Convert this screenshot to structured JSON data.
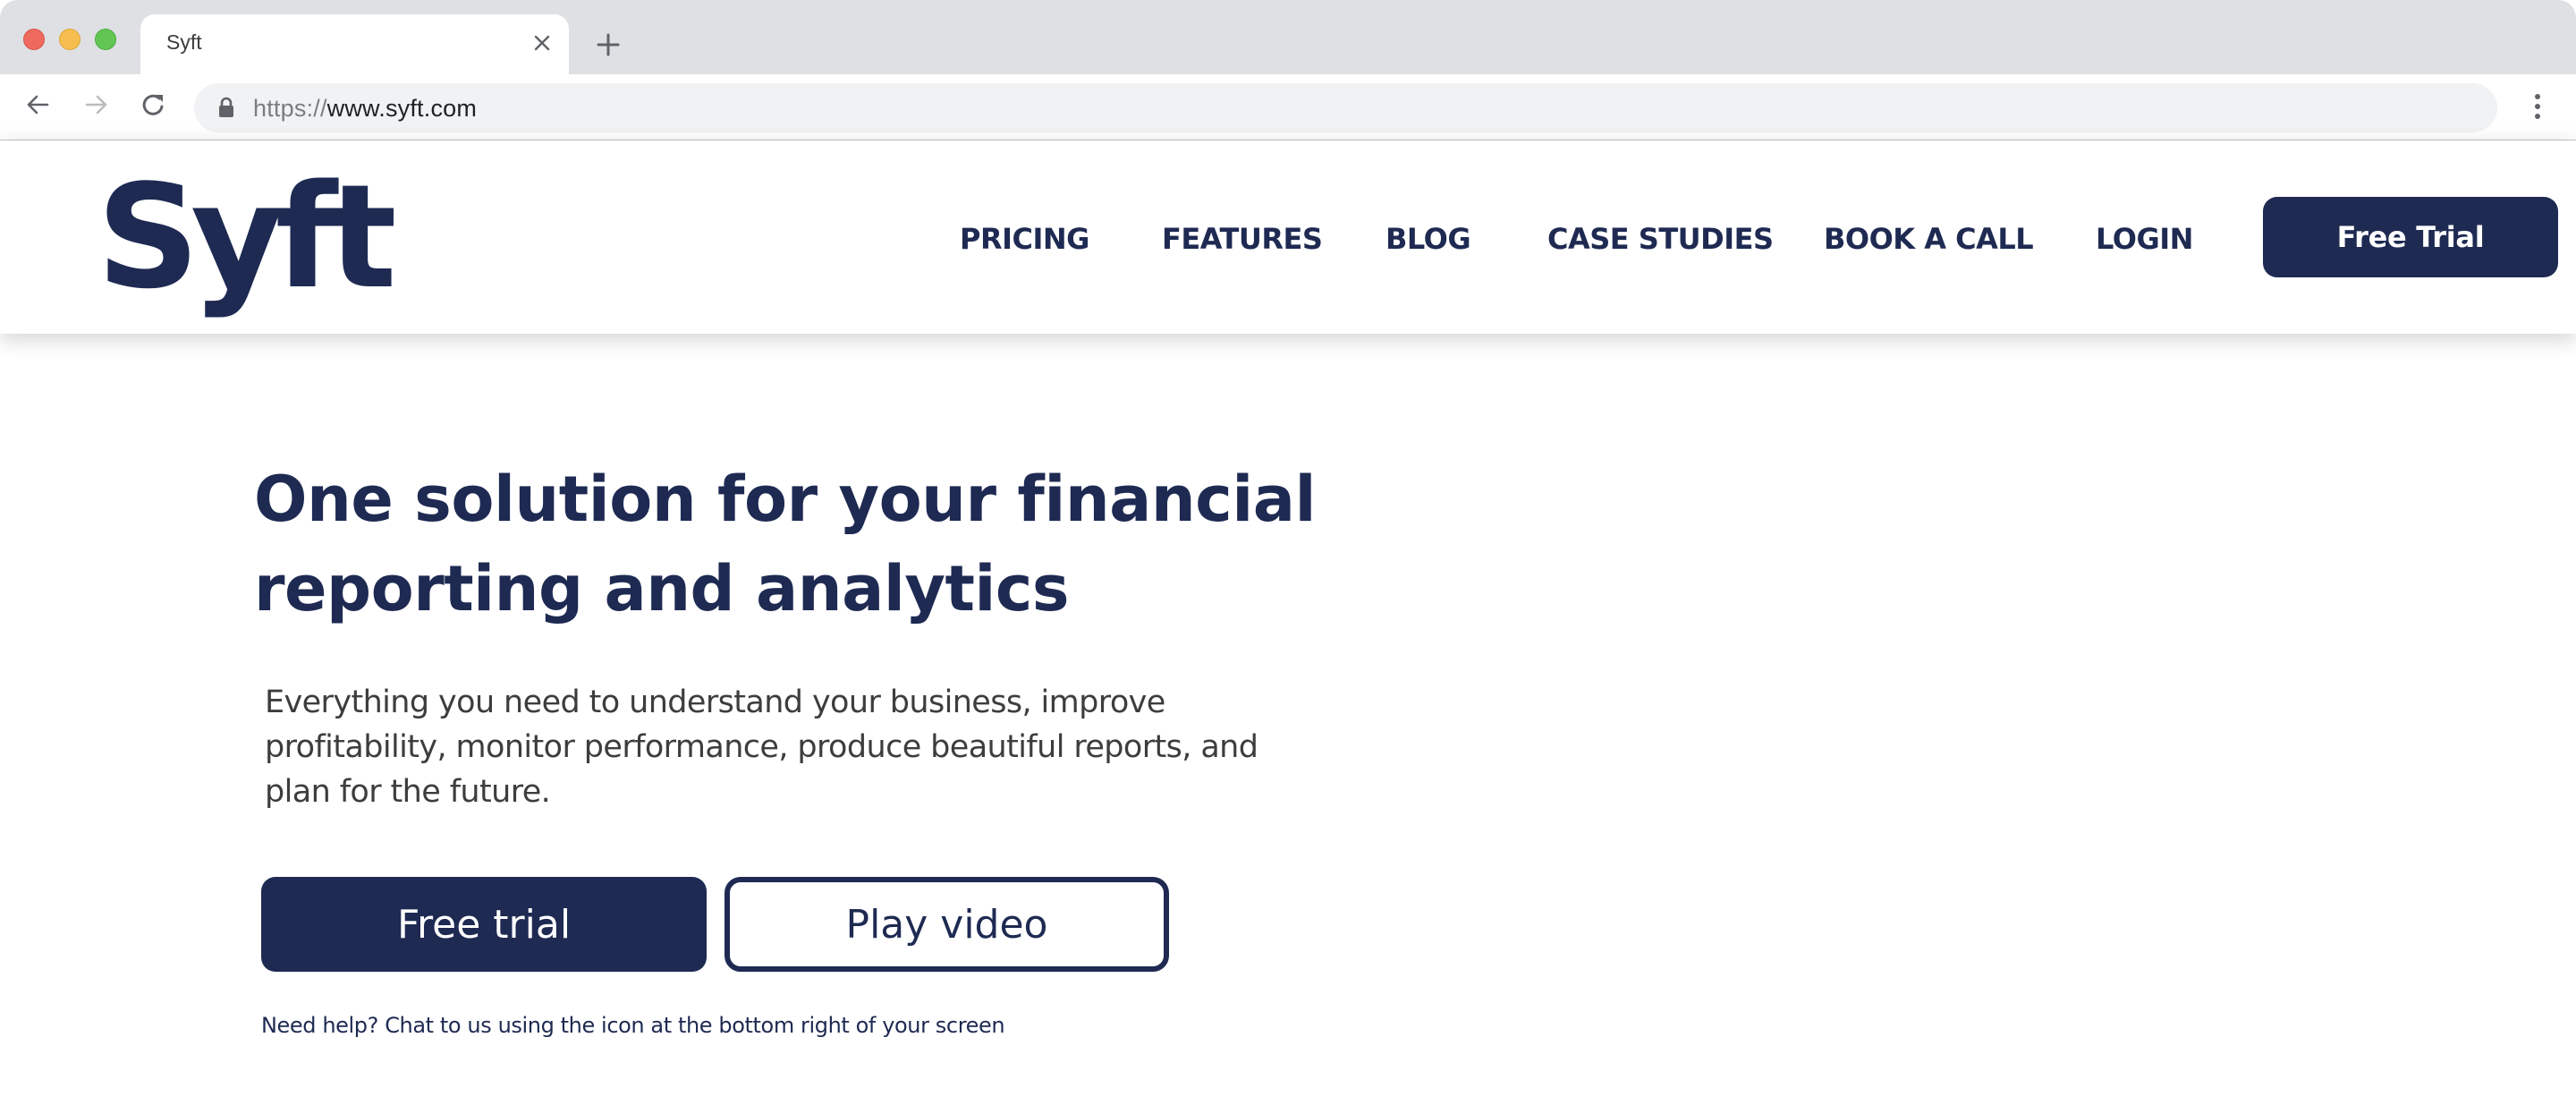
{
  "browser": {
    "tab": {
      "title": "Syft",
      "close_icon": "close-icon"
    },
    "new_tab_icon": "plus-icon",
    "nav": {
      "back_icon": "arrow-left-icon",
      "forward_icon": "arrow-right-icon",
      "reload_icon": "reload-icon"
    },
    "address_bar": {
      "lock_icon": "lock-icon",
      "scheme": "https://",
      "host": "www.syft.com"
    },
    "menu_icon": "kebab-menu-icon"
  },
  "header": {
    "logo": "Syft",
    "nav": [
      {
        "label": "PRICING"
      },
      {
        "label": "FEATURES"
      },
      {
        "label": "BLOG"
      },
      {
        "label": "CASE STUDIES"
      },
      {
        "label": "BOOK A CALL"
      },
      {
        "label": "LOGIN"
      }
    ],
    "cta_label": "Free Trial"
  },
  "hero": {
    "title": "One solution for your financial reporting and analytics",
    "subtitle": "Everything you need to understand your business, improve profitability, monitor performance, produce beautiful reports, and plan for the future.",
    "primary_button": "Free trial",
    "secondary_button": "Play video",
    "help_text": "Need help? Chat to us using the icon at the bottom right of your screen"
  },
  "colors": {
    "brand": "#1e2a52",
    "body_text": "#3d3d3d",
    "chrome_bg": "#dfe0e4",
    "omnibox_bg": "#f1f2f4"
  }
}
